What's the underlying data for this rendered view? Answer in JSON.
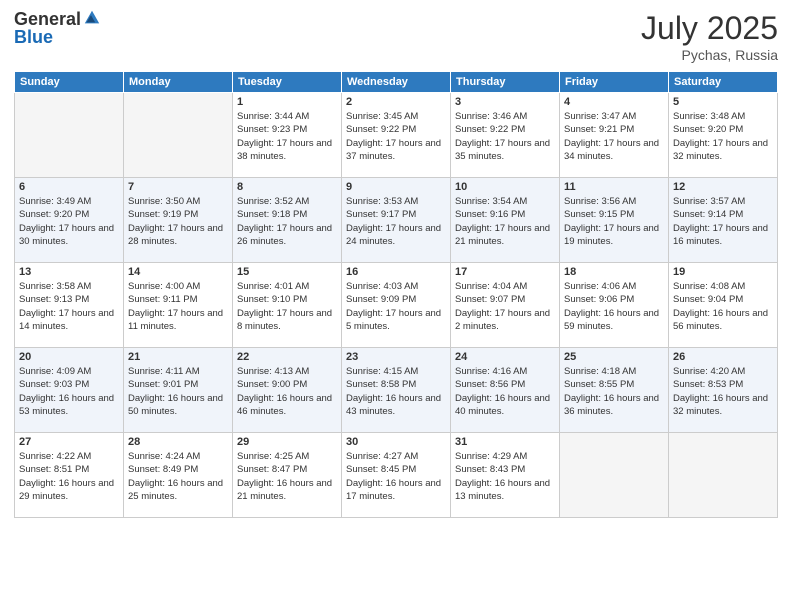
{
  "header": {
    "logo_general": "General",
    "logo_blue": "Blue",
    "title": "July 2025",
    "location": "Pychas, Russia"
  },
  "days_of_week": [
    "Sunday",
    "Monday",
    "Tuesday",
    "Wednesday",
    "Thursday",
    "Friday",
    "Saturday"
  ],
  "weeks": [
    [
      {
        "day": "",
        "sunrise": "",
        "sunset": "",
        "daylight": ""
      },
      {
        "day": "",
        "sunrise": "",
        "sunset": "",
        "daylight": ""
      },
      {
        "day": "1",
        "sunrise": "Sunrise: 3:44 AM",
        "sunset": "Sunset: 9:23 PM",
        "daylight": "Daylight: 17 hours and 38 minutes."
      },
      {
        "day": "2",
        "sunrise": "Sunrise: 3:45 AM",
        "sunset": "Sunset: 9:22 PM",
        "daylight": "Daylight: 17 hours and 37 minutes."
      },
      {
        "day": "3",
        "sunrise": "Sunrise: 3:46 AM",
        "sunset": "Sunset: 9:22 PM",
        "daylight": "Daylight: 17 hours and 35 minutes."
      },
      {
        "day": "4",
        "sunrise": "Sunrise: 3:47 AM",
        "sunset": "Sunset: 9:21 PM",
        "daylight": "Daylight: 17 hours and 34 minutes."
      },
      {
        "day": "5",
        "sunrise": "Sunrise: 3:48 AM",
        "sunset": "Sunset: 9:20 PM",
        "daylight": "Daylight: 17 hours and 32 minutes."
      }
    ],
    [
      {
        "day": "6",
        "sunrise": "Sunrise: 3:49 AM",
        "sunset": "Sunset: 9:20 PM",
        "daylight": "Daylight: 17 hours and 30 minutes."
      },
      {
        "day": "7",
        "sunrise": "Sunrise: 3:50 AM",
        "sunset": "Sunset: 9:19 PM",
        "daylight": "Daylight: 17 hours and 28 minutes."
      },
      {
        "day": "8",
        "sunrise": "Sunrise: 3:52 AM",
        "sunset": "Sunset: 9:18 PM",
        "daylight": "Daylight: 17 hours and 26 minutes."
      },
      {
        "day": "9",
        "sunrise": "Sunrise: 3:53 AM",
        "sunset": "Sunset: 9:17 PM",
        "daylight": "Daylight: 17 hours and 24 minutes."
      },
      {
        "day": "10",
        "sunrise": "Sunrise: 3:54 AM",
        "sunset": "Sunset: 9:16 PM",
        "daylight": "Daylight: 17 hours and 21 minutes."
      },
      {
        "day": "11",
        "sunrise": "Sunrise: 3:56 AM",
        "sunset": "Sunset: 9:15 PM",
        "daylight": "Daylight: 17 hours and 19 minutes."
      },
      {
        "day": "12",
        "sunrise": "Sunrise: 3:57 AM",
        "sunset": "Sunset: 9:14 PM",
        "daylight": "Daylight: 17 hours and 16 minutes."
      }
    ],
    [
      {
        "day": "13",
        "sunrise": "Sunrise: 3:58 AM",
        "sunset": "Sunset: 9:13 PM",
        "daylight": "Daylight: 17 hours and 14 minutes."
      },
      {
        "day": "14",
        "sunrise": "Sunrise: 4:00 AM",
        "sunset": "Sunset: 9:11 PM",
        "daylight": "Daylight: 17 hours and 11 minutes."
      },
      {
        "day": "15",
        "sunrise": "Sunrise: 4:01 AM",
        "sunset": "Sunset: 9:10 PM",
        "daylight": "Daylight: 17 hours and 8 minutes."
      },
      {
        "day": "16",
        "sunrise": "Sunrise: 4:03 AM",
        "sunset": "Sunset: 9:09 PM",
        "daylight": "Daylight: 17 hours and 5 minutes."
      },
      {
        "day": "17",
        "sunrise": "Sunrise: 4:04 AM",
        "sunset": "Sunset: 9:07 PM",
        "daylight": "Daylight: 17 hours and 2 minutes."
      },
      {
        "day": "18",
        "sunrise": "Sunrise: 4:06 AM",
        "sunset": "Sunset: 9:06 PM",
        "daylight": "Daylight: 16 hours and 59 minutes."
      },
      {
        "day": "19",
        "sunrise": "Sunrise: 4:08 AM",
        "sunset": "Sunset: 9:04 PM",
        "daylight": "Daylight: 16 hours and 56 minutes."
      }
    ],
    [
      {
        "day": "20",
        "sunrise": "Sunrise: 4:09 AM",
        "sunset": "Sunset: 9:03 PM",
        "daylight": "Daylight: 16 hours and 53 minutes."
      },
      {
        "day": "21",
        "sunrise": "Sunrise: 4:11 AM",
        "sunset": "Sunset: 9:01 PM",
        "daylight": "Daylight: 16 hours and 50 minutes."
      },
      {
        "day": "22",
        "sunrise": "Sunrise: 4:13 AM",
        "sunset": "Sunset: 9:00 PM",
        "daylight": "Daylight: 16 hours and 46 minutes."
      },
      {
        "day": "23",
        "sunrise": "Sunrise: 4:15 AM",
        "sunset": "Sunset: 8:58 PM",
        "daylight": "Daylight: 16 hours and 43 minutes."
      },
      {
        "day": "24",
        "sunrise": "Sunrise: 4:16 AM",
        "sunset": "Sunset: 8:56 PM",
        "daylight": "Daylight: 16 hours and 40 minutes."
      },
      {
        "day": "25",
        "sunrise": "Sunrise: 4:18 AM",
        "sunset": "Sunset: 8:55 PM",
        "daylight": "Daylight: 16 hours and 36 minutes."
      },
      {
        "day": "26",
        "sunrise": "Sunrise: 4:20 AM",
        "sunset": "Sunset: 8:53 PM",
        "daylight": "Daylight: 16 hours and 32 minutes."
      }
    ],
    [
      {
        "day": "27",
        "sunrise": "Sunrise: 4:22 AM",
        "sunset": "Sunset: 8:51 PM",
        "daylight": "Daylight: 16 hours and 29 minutes."
      },
      {
        "day": "28",
        "sunrise": "Sunrise: 4:24 AM",
        "sunset": "Sunset: 8:49 PM",
        "daylight": "Daylight: 16 hours and 25 minutes."
      },
      {
        "day": "29",
        "sunrise": "Sunrise: 4:25 AM",
        "sunset": "Sunset: 8:47 PM",
        "daylight": "Daylight: 16 hours and 21 minutes."
      },
      {
        "day": "30",
        "sunrise": "Sunrise: 4:27 AM",
        "sunset": "Sunset: 8:45 PM",
        "daylight": "Daylight: 16 hours and 17 minutes."
      },
      {
        "day": "31",
        "sunrise": "Sunrise: 4:29 AM",
        "sunset": "Sunset: 8:43 PM",
        "daylight": "Daylight: 16 hours and 13 minutes."
      },
      {
        "day": "",
        "sunrise": "",
        "sunset": "",
        "daylight": ""
      },
      {
        "day": "",
        "sunrise": "",
        "sunset": "",
        "daylight": ""
      }
    ]
  ]
}
